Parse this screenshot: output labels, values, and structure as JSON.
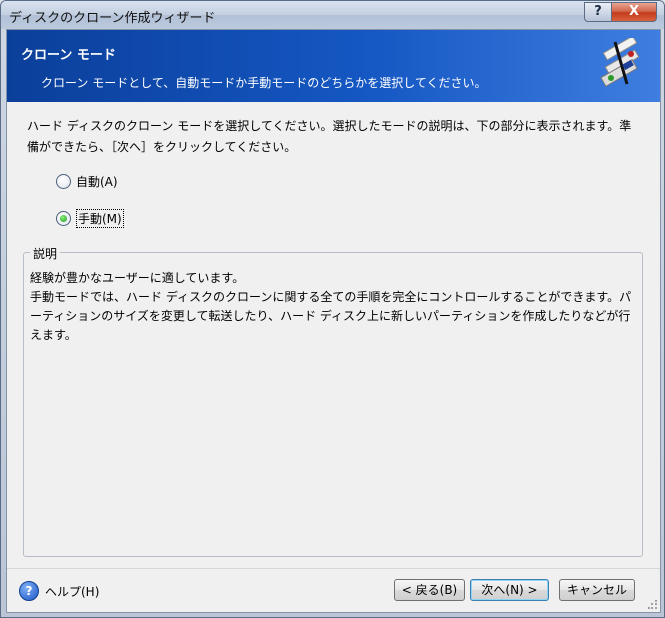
{
  "window": {
    "title": "ディスクのクローン作成ウィザード",
    "help_btn": "?",
    "close_btn": "X"
  },
  "header": {
    "title": "クローン モード",
    "subtitle": "クローン モードとして、自動モードか手動モードのどちらかを選択してください。",
    "icon": "disk-clone-icon"
  },
  "instruction": "ハード ディスクのクローン モードを選択してください。選択したモードの説明は、下の部分に表示されます。準備ができたら、［次へ］をクリックしてください。",
  "options": {
    "auto": {
      "label": "自動(A)",
      "checked": false
    },
    "manual": {
      "label": "手動(M)",
      "checked": true
    }
  },
  "description": {
    "legend": "説明",
    "text": "経験が豊かなユーザーに適しています。\n手動モードでは、ハード ディスクのクローンに関する全ての手順を完全にコントロールすることができます。パーティションのサイズを変更して転送したり、ハード ディスク上に新しいパーティションを作成したりなどが行えます。"
  },
  "footer": {
    "help_icon": "?",
    "help_label": "ヘルプ(H)",
    "back_label": "< 戻る(B)",
    "next_label": "次へ(N) >",
    "cancel_label": "キャンセル"
  }
}
